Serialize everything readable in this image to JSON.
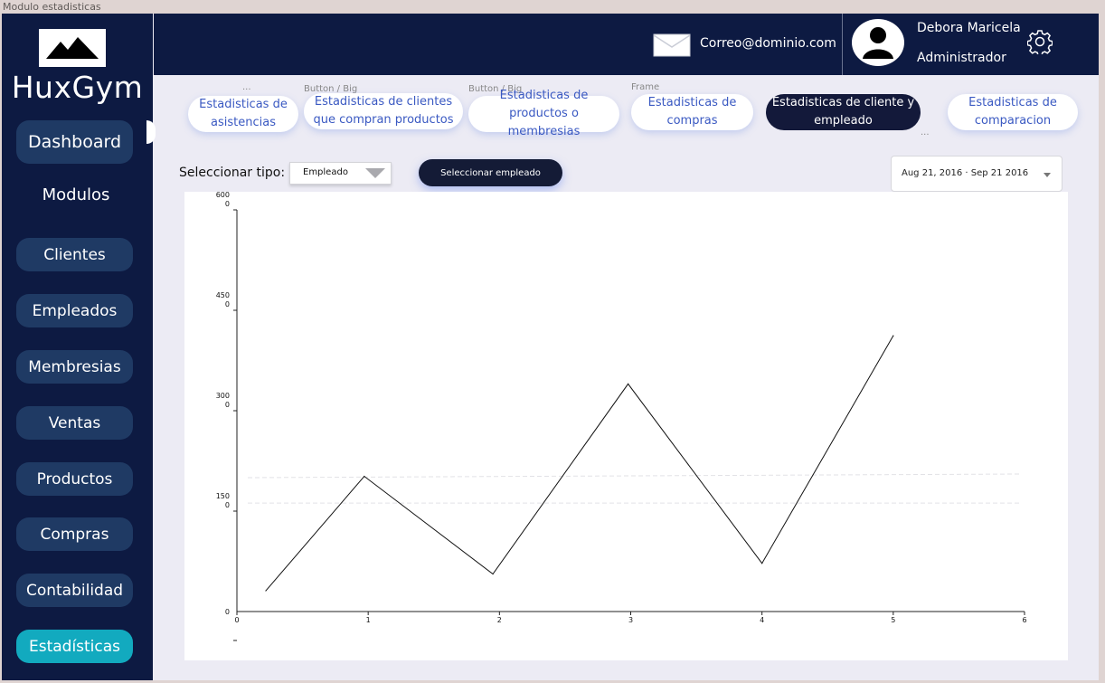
{
  "window": {
    "title": "Modulo estadisticas"
  },
  "sidebar": {
    "brand": "HuxGym",
    "dashboard": "Dashboard",
    "section_title": "Modulos",
    "items": [
      "Clientes",
      "Empleados",
      "Membresias",
      "Ventas",
      "Productos",
      "Compras",
      "Contabilidad",
      "Estadísticas"
    ],
    "active": "Estadísticas"
  },
  "header": {
    "email": "Correo@dominio.com",
    "user_name": "Debora Maricela",
    "user_role": "Administrador"
  },
  "tabs": [
    {
      "label": "Estadisticas de asistencias",
      "caption": "..."
    },
    {
      "label": "Estadisticas de clientes que compran productos",
      "caption": "Button / Big"
    },
    {
      "label": "Estadisticas de productos o membresias",
      "caption": "Button / Big"
    },
    {
      "label": "Estadisticas de compras",
      "caption": "Frame"
    },
    {
      "label": "Estadisticas de cliente y empleado",
      "caption": "...",
      "active": true
    },
    {
      "label": "Estadisticas de comparacion",
      "caption": ""
    }
  ],
  "controls": {
    "select_label": "Seleccionar tipo:",
    "type_value": "Empleado",
    "employee_button": "Seleccionar empleado",
    "date_range": "Aug 21, 2016 · Sep 21 2016"
  },
  "colors": {
    "sidebar": "#0d1a42",
    "nav_button": "#1f3a64",
    "active_nav": "#12aabf",
    "active_tab": "#13193a",
    "tab_text": "#3a59c2"
  },
  "chart_data": {
    "type": "line",
    "title": "",
    "xlabel": "",
    "ylabel": "",
    "xlim": [
      0,
      6
    ],
    "ylim": [
      0,
      6000
    ],
    "x_ticks": [
      "0",
      "1",
      "2",
      "3",
      "4",
      "5",
      "6"
    ],
    "y_ticks": [
      {
        "value": 0,
        "label": "0"
      },
      {
        "value": 1500,
        "label": "150\n0"
      },
      {
        "value": 3000,
        "label": "300\n0"
      },
      {
        "value": 4500,
        "label": "450\n0"
      },
      {
        "value": 6000,
        "label": "600\n0"
      }
    ],
    "series": [
      {
        "x": [
          0.22,
          0.97,
          1.95,
          2.98,
          4.0,
          5.0
        ],
        "y": [
          310,
          2020,
          560,
          3400,
          720,
          4120
        ]
      }
    ],
    "reference_lines": [
      2000,
      1620
    ],
    "grid": false
  }
}
